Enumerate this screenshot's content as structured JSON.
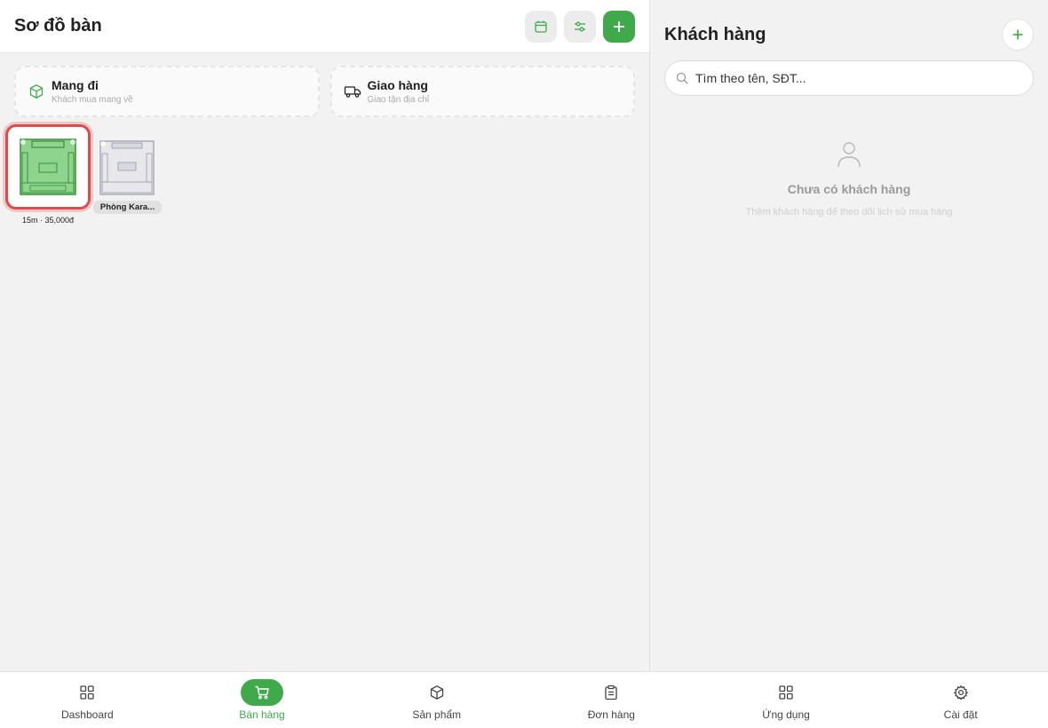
{
  "header": {
    "title": "Sơ đồ bàn"
  },
  "services": [
    {
      "title": "Mang đi",
      "subtitle": "Khách mua mang về",
      "icon": "box-icon"
    },
    {
      "title": "Giao hàng",
      "subtitle": "Giao tận địa chỉ",
      "icon": "truck-icon"
    }
  ],
  "tables": [
    {
      "label": "15m · 35,000đ",
      "status": "occupied"
    },
    {
      "label": "Phòng Kara...",
      "status": "empty"
    }
  ],
  "customers": {
    "title": "Khách hàng",
    "search_placeholder": "Tìm theo tên, SĐT...",
    "empty_title": "Chưa có khách hàng",
    "empty_subtitle": "Thêm khách hàng để theo dõi lịch sử mua hàng"
  },
  "nav": [
    {
      "label": "Dashboard",
      "icon": "grid-icon"
    },
    {
      "label": "Bán hàng",
      "icon": "cart-icon",
      "active": true
    },
    {
      "label": "Sản phẩm",
      "icon": "box-icon"
    },
    {
      "label": "Đơn hàng",
      "icon": "clipboard-icon"
    },
    {
      "label": "Ứng dụng",
      "icon": "apps-icon"
    },
    {
      "label": "Cài đặt",
      "icon": "gear-icon"
    }
  ],
  "colors": {
    "accent": "#3fa94b",
    "selected_border": "#e04a4a"
  }
}
